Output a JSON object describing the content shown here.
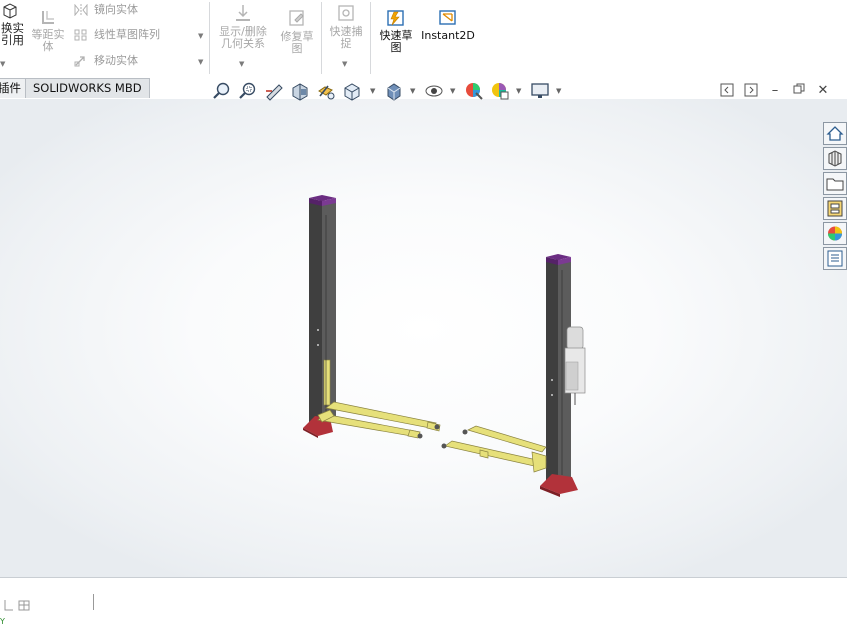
{
  "ribbon": {
    "convert_entities": "换实\n引用",
    "offset_entities": "等距实\n体",
    "mirror_entities": "镜向实体",
    "linear_pattern": "线性草图阵列",
    "move_entities": "移动实体",
    "display_delete_relations": "显示/删除\n几何关系",
    "repair_sketch": "修复草\n图",
    "quick_snaps": "快速捕\n捉",
    "rapid_sketch": "快速草\n图",
    "instant2d": "Instant2D"
  },
  "tabs": [
    {
      "label": "插件",
      "active": false
    },
    {
      "label": "SOLIDWORKS MBD",
      "active": true
    }
  ],
  "heads_up_toolbar": {
    "icons": [
      "zoom-to-fit-icon",
      "zoom-to-area-icon",
      "previous-view-icon",
      "section-view-icon",
      "view-orientation-icon",
      "display-style-icon",
      "hide-show-items-icon",
      "edit-appearance-icon",
      "apply-scene-icon",
      "view-settings-icon"
    ]
  },
  "window_controls": [
    "tile-left-icon",
    "tile-right-icon",
    "minimize-icon",
    "restore-icon",
    "close-icon"
  ],
  "taskpane": [
    "solidworks-resources-icon",
    "design-library-icon",
    "file-explorer-icon",
    "view-palette-icon",
    "appearances-icon",
    "custom-properties-icon"
  ],
  "triad_label": "Y",
  "colors": {
    "column": "#5a5a5a",
    "column_dark": "#3f3f3f",
    "cap": "#6b2d82",
    "arm": "#e6e07a",
    "arm_edge": "#8a8340",
    "base": "#b2323a",
    "motor": "#dcdcdc"
  }
}
